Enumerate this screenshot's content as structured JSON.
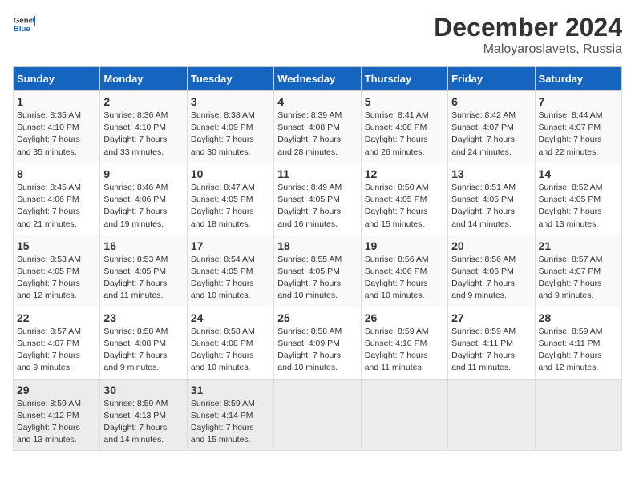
{
  "header": {
    "logo_line1": "General",
    "logo_line2": "Blue",
    "month": "December 2024",
    "location": "Maloyaroslavets, Russia"
  },
  "days_of_week": [
    "Sunday",
    "Monday",
    "Tuesday",
    "Wednesday",
    "Thursday",
    "Friday",
    "Saturday"
  ],
  "weeks": [
    [
      {
        "day": "1",
        "info": "Sunrise: 8:35 AM\nSunset: 4:10 PM\nDaylight: 7 hours\nand 35 minutes."
      },
      {
        "day": "2",
        "info": "Sunrise: 8:36 AM\nSunset: 4:10 PM\nDaylight: 7 hours\nand 33 minutes."
      },
      {
        "day": "3",
        "info": "Sunrise: 8:38 AM\nSunset: 4:09 PM\nDaylight: 7 hours\nand 30 minutes."
      },
      {
        "day": "4",
        "info": "Sunrise: 8:39 AM\nSunset: 4:08 PM\nDaylight: 7 hours\nand 28 minutes."
      },
      {
        "day": "5",
        "info": "Sunrise: 8:41 AM\nSunset: 4:08 PM\nDaylight: 7 hours\nand 26 minutes."
      },
      {
        "day": "6",
        "info": "Sunrise: 8:42 AM\nSunset: 4:07 PM\nDaylight: 7 hours\nand 24 minutes."
      },
      {
        "day": "7",
        "info": "Sunrise: 8:44 AM\nSunset: 4:07 PM\nDaylight: 7 hours\nand 22 minutes."
      }
    ],
    [
      {
        "day": "8",
        "info": "Sunrise: 8:45 AM\nSunset: 4:06 PM\nDaylight: 7 hours\nand 21 minutes."
      },
      {
        "day": "9",
        "info": "Sunrise: 8:46 AM\nSunset: 4:06 PM\nDaylight: 7 hours\nand 19 minutes."
      },
      {
        "day": "10",
        "info": "Sunrise: 8:47 AM\nSunset: 4:05 PM\nDaylight: 7 hours\nand 18 minutes."
      },
      {
        "day": "11",
        "info": "Sunrise: 8:49 AM\nSunset: 4:05 PM\nDaylight: 7 hours\nand 16 minutes."
      },
      {
        "day": "12",
        "info": "Sunrise: 8:50 AM\nSunset: 4:05 PM\nDaylight: 7 hours\nand 15 minutes."
      },
      {
        "day": "13",
        "info": "Sunrise: 8:51 AM\nSunset: 4:05 PM\nDaylight: 7 hours\nand 14 minutes."
      },
      {
        "day": "14",
        "info": "Sunrise: 8:52 AM\nSunset: 4:05 PM\nDaylight: 7 hours\nand 13 minutes."
      }
    ],
    [
      {
        "day": "15",
        "info": "Sunrise: 8:53 AM\nSunset: 4:05 PM\nDaylight: 7 hours\nand 12 minutes."
      },
      {
        "day": "16",
        "info": "Sunrise: 8:53 AM\nSunset: 4:05 PM\nDaylight: 7 hours\nand 11 minutes."
      },
      {
        "day": "17",
        "info": "Sunrise: 8:54 AM\nSunset: 4:05 PM\nDaylight: 7 hours\nand 10 minutes."
      },
      {
        "day": "18",
        "info": "Sunrise: 8:55 AM\nSunset: 4:05 PM\nDaylight: 7 hours\nand 10 minutes."
      },
      {
        "day": "19",
        "info": "Sunrise: 8:56 AM\nSunset: 4:06 PM\nDaylight: 7 hours\nand 10 minutes."
      },
      {
        "day": "20",
        "info": "Sunrise: 8:56 AM\nSunset: 4:06 PM\nDaylight: 7 hours\nand 9 minutes."
      },
      {
        "day": "21",
        "info": "Sunrise: 8:57 AM\nSunset: 4:07 PM\nDaylight: 7 hours\nand 9 minutes."
      }
    ],
    [
      {
        "day": "22",
        "info": "Sunrise: 8:57 AM\nSunset: 4:07 PM\nDaylight: 7 hours\nand 9 minutes."
      },
      {
        "day": "23",
        "info": "Sunrise: 8:58 AM\nSunset: 4:08 PM\nDaylight: 7 hours\nand 9 minutes."
      },
      {
        "day": "24",
        "info": "Sunrise: 8:58 AM\nSunset: 4:08 PM\nDaylight: 7 hours\nand 10 minutes."
      },
      {
        "day": "25",
        "info": "Sunrise: 8:58 AM\nSunset: 4:09 PM\nDaylight: 7 hours\nand 10 minutes."
      },
      {
        "day": "26",
        "info": "Sunrise: 8:59 AM\nSunset: 4:10 PM\nDaylight: 7 hours\nand 11 minutes."
      },
      {
        "day": "27",
        "info": "Sunrise: 8:59 AM\nSunset: 4:11 PM\nDaylight: 7 hours\nand 11 minutes."
      },
      {
        "day": "28",
        "info": "Sunrise: 8:59 AM\nSunset: 4:11 PM\nDaylight: 7 hours\nand 12 minutes."
      }
    ],
    [
      {
        "day": "29",
        "info": "Sunrise: 8:59 AM\nSunset: 4:12 PM\nDaylight: 7 hours\nand 13 minutes."
      },
      {
        "day": "30",
        "info": "Sunrise: 8:59 AM\nSunset: 4:13 PM\nDaylight: 7 hours\nand 14 minutes."
      },
      {
        "day": "31",
        "info": "Sunrise: 8:59 AM\nSunset: 4:14 PM\nDaylight: 7 hours\nand 15 minutes."
      },
      {
        "day": "",
        "info": ""
      },
      {
        "day": "",
        "info": ""
      },
      {
        "day": "",
        "info": ""
      },
      {
        "day": "",
        "info": ""
      }
    ]
  ]
}
